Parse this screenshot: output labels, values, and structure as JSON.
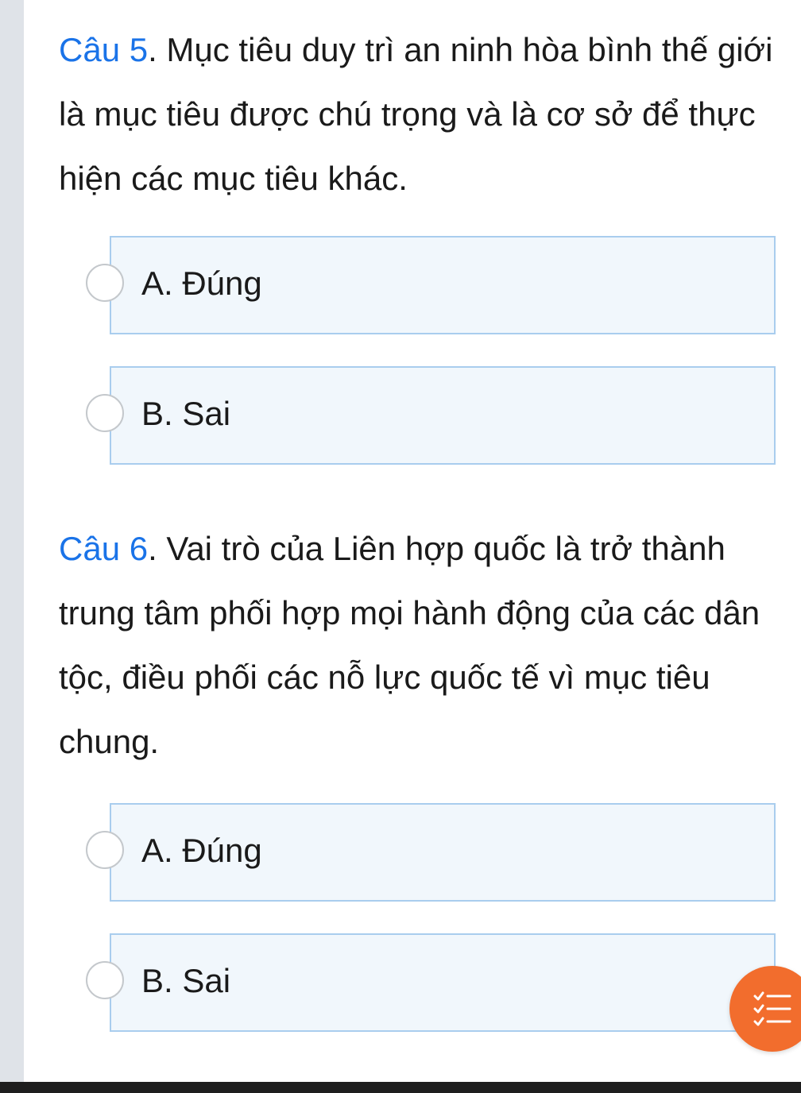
{
  "questions": [
    {
      "number": "Câu 5",
      "text": ". Mục tiêu duy trì an ninh hòa bình thế giới là mục tiêu được chú trọng và là cơ sở để thực hiện các mục tiêu khác.",
      "options": [
        {
          "label": "A. Đúng"
        },
        {
          "label": "B. Sai"
        }
      ]
    },
    {
      "number": "Câu 6",
      "text": ". Vai trò của Liên hợp quốc là trở thành trung tâm phối hợp mọi hành động của các dân tộc, điều phối các nỗ lực quốc tế vì mục tiêu chung.",
      "options": [
        {
          "label": "A. Đúng"
        },
        {
          "label": "B. Sai"
        }
      ]
    }
  ],
  "fab": {
    "icon": "checklist-icon",
    "color": "#f26d2d"
  },
  "colors": {
    "accent": "#1a73e8",
    "option_bg": "#f1f7fc",
    "option_border": "#a9cdee"
  }
}
